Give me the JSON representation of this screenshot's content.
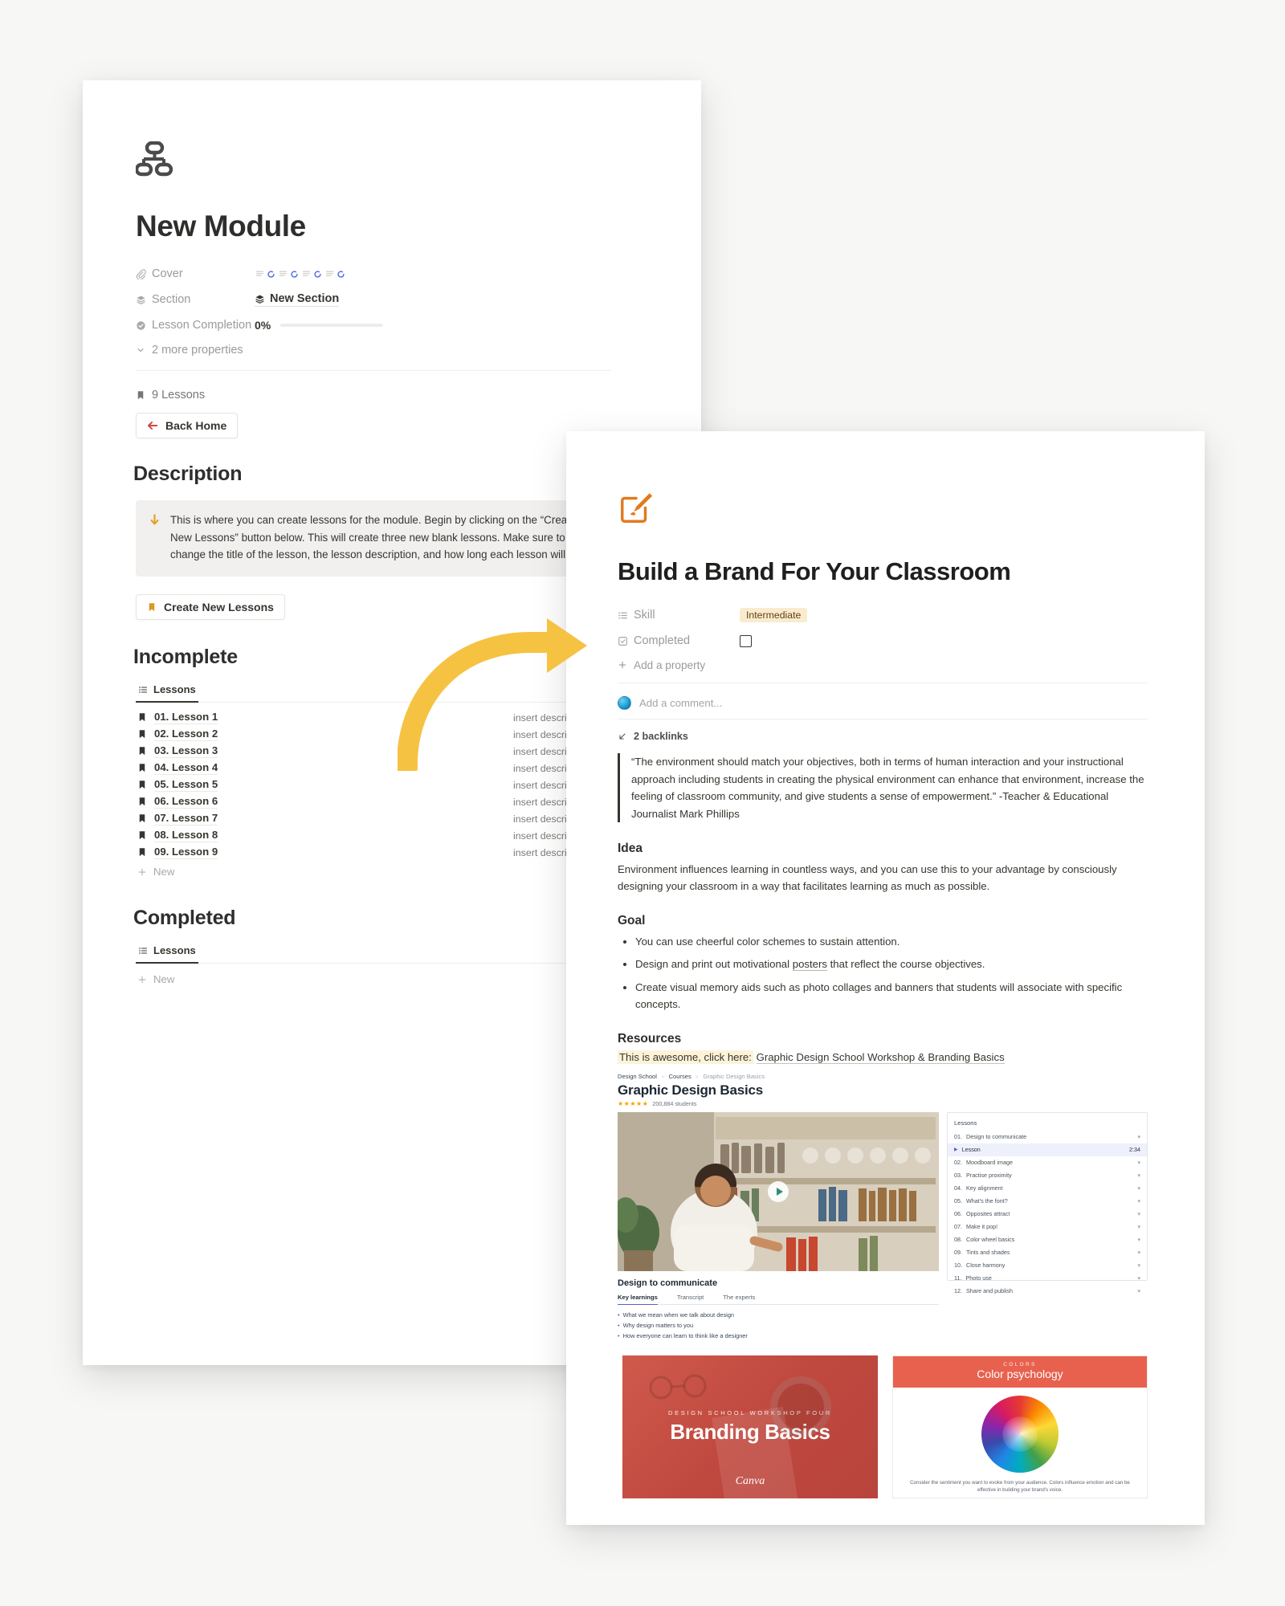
{
  "module_card": {
    "icon": "org-chart-icon",
    "title": "New Module",
    "properties": [
      {
        "label": "Cover",
        "icon": "paperclip-icon",
        "value": ""
      },
      {
        "label": "Section",
        "icon": "layers-icon",
        "value": "New Section"
      },
      {
        "label": "Lesson Completion",
        "icon": "check-circle-icon",
        "value": "0%"
      }
    ],
    "more_properties": "2 more properties",
    "lesson_count": "9 Lessons",
    "back_home_button": "Back Home",
    "description_heading": "Description",
    "callout_text": "This is where you can create lessons for the module. Begin by clicking on the “Create New Lessons” button below. This will create three new blank lessons. Make sure to change the title of the lesson, the lesson description, and how long each lesson will take.",
    "create_button": "Create New Lessons",
    "incomplete_heading": "Incomplete",
    "completed_heading": "Completed",
    "db_tab_label": "Lessons",
    "new_row_label": "New",
    "lessons": [
      {
        "title": "01. Lesson 1",
        "description": "insert description",
        "hash": "#"
      },
      {
        "title": "02. Lesson 2",
        "description": "insert description",
        "hash": "#"
      },
      {
        "title": "03. Lesson 3",
        "description": "insert description",
        "hash": "#"
      },
      {
        "title": "04. Lesson 4",
        "description": "insert description",
        "hash": "#"
      },
      {
        "title": "05. Lesson 5",
        "description": "insert description",
        "hash": "#"
      },
      {
        "title": "06. Lesson 6",
        "description": "insert description",
        "hash": "#"
      },
      {
        "title": "07. Lesson 7",
        "description": "insert description",
        "hash": "#"
      },
      {
        "title": "08. Lesson 8",
        "description": "insert description",
        "hash": "#"
      },
      {
        "title": "09. Lesson 9",
        "description": "insert description",
        "hash": "#"
      }
    ]
  },
  "lesson_card": {
    "icon": "paint-edit-icon",
    "title": "Build a Brand For Your Classroom",
    "skill_label": "Skill",
    "skill_value": "Intermediate",
    "completed_label": "Completed",
    "add_property": "Add a property",
    "comment_placeholder": "Add a comment...",
    "backlinks": "2 backlinks",
    "quote": "“The environment should match your objectives, both in terms of human interaction and your instructional approach including students in creating the physical environment can enhance that environment, increase the feeling of classroom community, and give students a sense of empowerment.” -Teacher & Educational Journalist Mark Phillips",
    "idea_heading": "Idea",
    "idea_text": "Environment influences learning in countless ways, and you can use this to your advantage by consciously designing your classroom in a way that facilitates learning as much as possible.",
    "goal_heading": "Goal",
    "goals": [
      "You can use cheerful color schemes to sustain attention.",
      "Design and print out motivational posters that reflect the course objectives.",
      "Create visual memory aids such as photo collages and banners that students will associate with specific concepts."
    ],
    "goal_link_word": "posters",
    "resources_heading": "Resources",
    "resource_highlight": "This is awesome, click here:",
    "resource_link": "Graphic Design School Workshop & Branding Basics",
    "embed": {
      "breadcrumbs": [
        "Design School",
        "Courses",
        "Graphic Design Basics"
      ],
      "title": "Graphic Design Basics",
      "stars": "★★★★★",
      "students": "200,884 students",
      "video_title": "Design to communicate",
      "tabs": [
        "Key learnings",
        "Transcript",
        "The experts"
      ],
      "bullets": [
        "What we mean when we talk about design",
        "Why design matters to you",
        "How everyone can learn to think like a designer"
      ],
      "panel_heading": "Lessons",
      "panel_items": [
        {
          "num": "01.",
          "name": "Design to communicate",
          "meta": ""
        },
        {
          "num": "",
          "name": "Lesson",
          "meta": "2:34",
          "current": true
        },
        {
          "num": "02.",
          "name": "Moodboard image",
          "meta": ""
        },
        {
          "num": "03.",
          "name": "Practise proximity",
          "meta": ""
        },
        {
          "num": "04.",
          "name": "Key alignment",
          "meta": ""
        },
        {
          "num": "05.",
          "name": "What's the font?",
          "meta": ""
        },
        {
          "num": "06.",
          "name": "Opposites attract",
          "meta": ""
        },
        {
          "num": "07.",
          "name": "Make it pop!",
          "meta": ""
        },
        {
          "num": "08.",
          "name": "Color wheel basics",
          "meta": ""
        },
        {
          "num": "09.",
          "name": "Tints and shades",
          "meta": ""
        },
        {
          "num": "10.",
          "name": "Close harmony",
          "meta": ""
        },
        {
          "num": "11.",
          "name": "Photo use",
          "meta": ""
        },
        {
          "num": "12.",
          "name": "Share and publish",
          "meta": ""
        }
      ]
    },
    "branding_card": {
      "kicker": "DESIGN SCHOOL WORKSHOP FOUR",
      "title": "Branding Basics",
      "logo": "Canva"
    },
    "psychology_card": {
      "kicker": "COLORS",
      "title": "Color psychology",
      "caption": "Consider the sentiment you want to evoke from your audience. Colors influence emotion and can be effective in building your brand's voice."
    }
  },
  "colors": {
    "accent_orange": "#e07b1f",
    "accent_yellow": "#f5c242",
    "accent_red": "#d64541",
    "tag_bg": "#faebcf",
    "highlight": "#fcf3d8",
    "canva_red": "#c0493f"
  }
}
